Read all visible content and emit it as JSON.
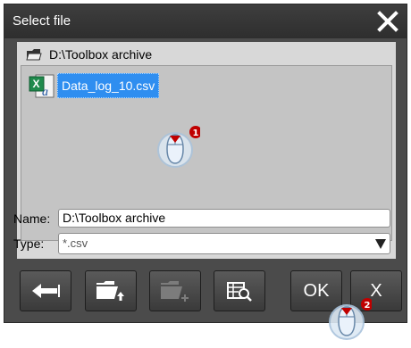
{
  "dialog": {
    "title": "Select file",
    "path": "D:\\Toolbox archive",
    "file": "Data_log_10.csv",
    "name_label": "Name:",
    "name_value": "D:\\Toolbox archive",
    "type_label": "Type:",
    "type_value": "*.csv"
  },
  "buttons": {
    "ok_label": "OK",
    "cancel_label": "X"
  },
  "callouts": {
    "step1": "1",
    "step2": "2"
  },
  "colors": {
    "selection": "#2f8ef0",
    "callout": "#c00000"
  },
  "icons": [
    "close-icon",
    "folder-icon",
    "excel-file-icon",
    "back-arrow-icon",
    "folder-up-icon",
    "new-folder-icon",
    "details-view-icon",
    "dropdown-arrow-icon",
    "mouse-cursor-icon"
  ]
}
